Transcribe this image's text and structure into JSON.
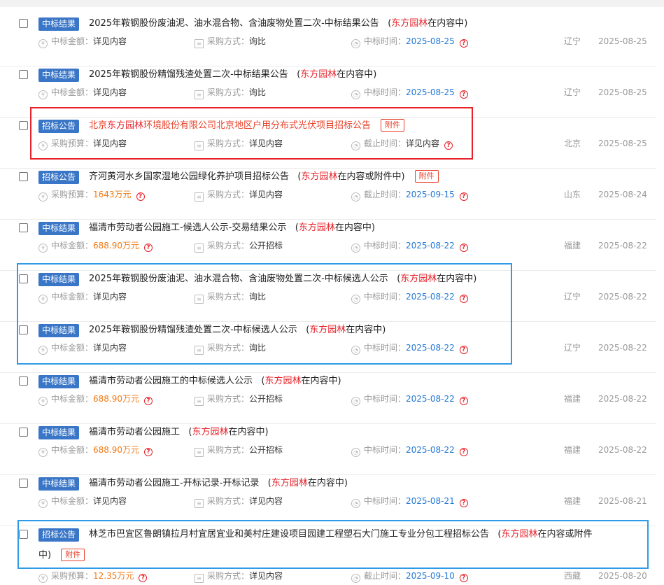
{
  "labels": {
    "amount": "中标金额：",
    "budget": "采购预算：",
    "method": "采购方式：",
    "win_time": "中标时间：",
    "deadline": "截止时间：",
    "attachment": "附件",
    "see_content": "详见内容"
  },
  "rows": [
    {
      "tag": "中标结果",
      "title": "2025年鞍钢股份废油泥、油水混合物、含油废物处置二次-中标结果公告",
      "hl_pre": "(",
      "hl": "东方园林",
      "hl_post": "在内容中)",
      "amount_label": "中标金额：",
      "amount": "详见内容",
      "method": "询比",
      "time_label": "中标时间：",
      "time": "2025-08-25",
      "region": "辽宁",
      "date": "2025-08-25"
    },
    {
      "tag": "中标结果",
      "title": "2025年鞍钢股份精馏残渣处置二次-中标结果公告",
      "hl_pre": "(",
      "hl": "东方园林",
      "hl_post": "在内容中)",
      "amount_label": "中标金额：",
      "amount": "详见内容",
      "method": "询比",
      "time_label": "中标时间：",
      "time": "2025-08-25",
      "region": "辽宁",
      "date": "2025-08-25"
    },
    {
      "tag": "招标公告",
      "title_pre": "北京",
      "title_hl": "东方园林",
      "title_post": "环境股份有限公司北京地区户用分布式光伏项目招标公告",
      "attachment": "附件",
      "amount_label": "采购预算：",
      "amount": "详见内容",
      "method": "详见内容",
      "time_label": "截止时间：",
      "time": "详见内容",
      "region": "北京",
      "date": "2025-08-25"
    },
    {
      "tag": "招标公告",
      "title": "齐河黄河水乡国家湿地公园绿化养护项目招标公告",
      "hl_pre": "(",
      "hl": "东方园林",
      "hl_post": "在内容或附件中)",
      "attachment": "附件",
      "amount_label": "采购预算：",
      "amount": "1643万元",
      "method": "详见内容",
      "time_label": "截止时间：",
      "time": "2025-09-15",
      "region": "山东",
      "date": "2025-08-24"
    },
    {
      "tag": "中标结果",
      "title": "福清市劳动者公园施工-候选人公示-交易结果公示",
      "hl_pre": "(",
      "hl": "东方园林",
      "hl_post": "在内容中)",
      "amount_label": "中标金额：",
      "amount": "688.90万元",
      "method": "公开招标",
      "time_label": "中标时间：",
      "time": "2025-08-22",
      "region": "福建",
      "date": "2025-08-22"
    },
    {
      "tag": "中标结果",
      "title": "2025年鞍钢股份废油泥、油水混合物、含油废物处置二次-中标候选人公示",
      "hl_pre": "(",
      "hl": "东方园林",
      "hl_post": "在内容中)",
      "amount_label": "中标金额：",
      "amount": "详见内容",
      "method": "询比",
      "time_label": "中标时间：",
      "time": "2025-08-22",
      "region": "辽宁",
      "date": "2025-08-22"
    },
    {
      "tag": "中标结果",
      "title": "2025年鞍钢股份精馏残渣处置二次-中标候选人公示",
      "hl_pre": "(",
      "hl": "东方园林",
      "hl_post": "在内容中)",
      "amount_label": "中标金额：",
      "amount": "详见内容",
      "method": "询比",
      "time_label": "中标时间：",
      "time": "2025-08-22",
      "region": "辽宁",
      "date": "2025-08-22"
    },
    {
      "tag": "中标结果",
      "title": "福清市劳动者公园施工的中标候选人公示",
      "hl_pre": "(",
      "hl": "东方园林",
      "hl_post": "在内容中)",
      "amount_label": "中标金额：",
      "amount": "688.90万元",
      "method": "公开招标",
      "time_label": "中标时间：",
      "time": "2025-08-22",
      "region": "福建",
      "date": "2025-08-22"
    },
    {
      "tag": "中标结果",
      "title": "福清市劳动者公园施工",
      "hl_pre": "(",
      "hl": "东方园林",
      "hl_post": "在内容中)",
      "amount_label": "中标金额：",
      "amount": "688.90万元",
      "method": "公开招标",
      "time_label": "中标时间：",
      "time": "2025-08-22",
      "region": "福建",
      "date": "2025-08-22"
    },
    {
      "tag": "中标结果",
      "title": "福清市劳动者公园施工-开标记录-开标记录",
      "hl_pre": "(",
      "hl": "东方园林",
      "hl_post": "在内容中)",
      "amount_label": "中标金额：",
      "amount": "详见内容",
      "method": "详见内容",
      "time_label": "中标时间：",
      "time": "2025-08-21",
      "region": "福建",
      "date": "2025-08-21"
    },
    {
      "tag": "招标公告",
      "title": "林芝市巴宜区鲁朗镇拉月村宜居宜业和美村庄建设项目园建工程塑石大门施工专业分包工程招标公告",
      "hl_pre": "(",
      "hl": "东方园林",
      "hl_post": "在内容或附件",
      "line2_text": "中)",
      "attachment": "附件",
      "amount_label": "采购预算：",
      "amount": "12.35万元",
      "method": "详见内容",
      "time_label": "截止时间：",
      "time": "2025-09-10",
      "region": "西藏",
      "date": "2025-08-20"
    }
  ],
  "colors": {
    "tag_bg": "#3a76c7",
    "highlight": "#e8222a",
    "orange": "#f07a16",
    "blue": "#2278d6",
    "red_box": "#e8222a",
    "blue_box": "#2f9ae6"
  }
}
